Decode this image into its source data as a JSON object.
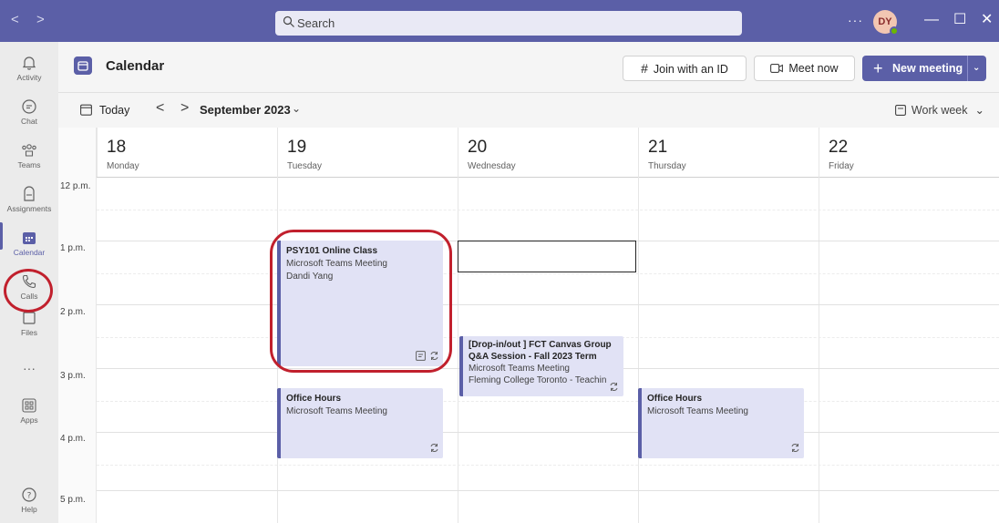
{
  "titlebar": {
    "back_glyph": "<",
    "forward_glyph": ">",
    "search_placeholder": "Search",
    "more_glyph": "···",
    "avatar_initials": "DY",
    "minimize_glyph": "—",
    "maximize_glyph": "☐",
    "close_glyph": "✕"
  },
  "rail": {
    "items": [
      {
        "label": "Activity",
        "icon": "bell-icon"
      },
      {
        "label": "Chat",
        "icon": "chat-icon"
      },
      {
        "label": "Teams",
        "icon": "teams-icon"
      },
      {
        "label": "Assignments",
        "icon": "assignments-icon"
      },
      {
        "label": "Calendar",
        "icon": "calendar-icon",
        "active": true
      },
      {
        "label": "Calls",
        "icon": "phone-icon"
      },
      {
        "label": "Files",
        "icon": "file-icon"
      },
      {
        "label": "Apps",
        "icon": "apps-icon"
      },
      {
        "label": "Help",
        "icon": "help-icon"
      }
    ],
    "more_glyph": "···"
  },
  "header": {
    "title": "Calendar",
    "join_label": "Join with an ID",
    "join_glyph": "#",
    "meet_now_label": "Meet now",
    "new_meeting_label": "New meeting",
    "new_meeting_glyph": "+",
    "new_meeting_chevron": "⌄"
  },
  "toolbar": {
    "today_label": "Today",
    "prev_glyph": "<",
    "next_glyph": ">",
    "month_label": "September 2023",
    "month_chevron": "⌄",
    "view_label": "Work week",
    "view_chevron": "⌄"
  },
  "days": [
    {
      "num": "18",
      "name": "Monday"
    },
    {
      "num": "19",
      "name": "Tuesday"
    },
    {
      "num": "20",
      "name": "Wednesday"
    },
    {
      "num": "21",
      "name": "Thursday"
    },
    {
      "num": "22",
      "name": "Friday"
    }
  ],
  "times": [
    "12 p.m.",
    "1 p.m.",
    "2 p.m.",
    "3 p.m.",
    "4 p.m.",
    "5 p.m."
  ],
  "events": {
    "psy101": {
      "title": "PSY101 Online Class",
      "line1": "Microsoft Teams Meeting",
      "line2": "Dandi Yang"
    },
    "canvas": {
      "title_1": "[Drop-in/out ] FCT Canvas Group",
      "title_2": "Q&A Session - Fall 2023 Term",
      "line1": "Microsoft Teams Meeting",
      "line2": "Fleming College Toronto - Teachin"
    },
    "office_tue": {
      "title": "Office Hours",
      "line1": "Microsoft Teams Meeting"
    },
    "office_thu": {
      "title": "Office Hours",
      "line1": "Microsoft Teams Meeting"
    }
  },
  "colors": {
    "accent": "#5b5fa7",
    "event_bg": "#e1e2f5",
    "annotation": "#c1202d"
  }
}
